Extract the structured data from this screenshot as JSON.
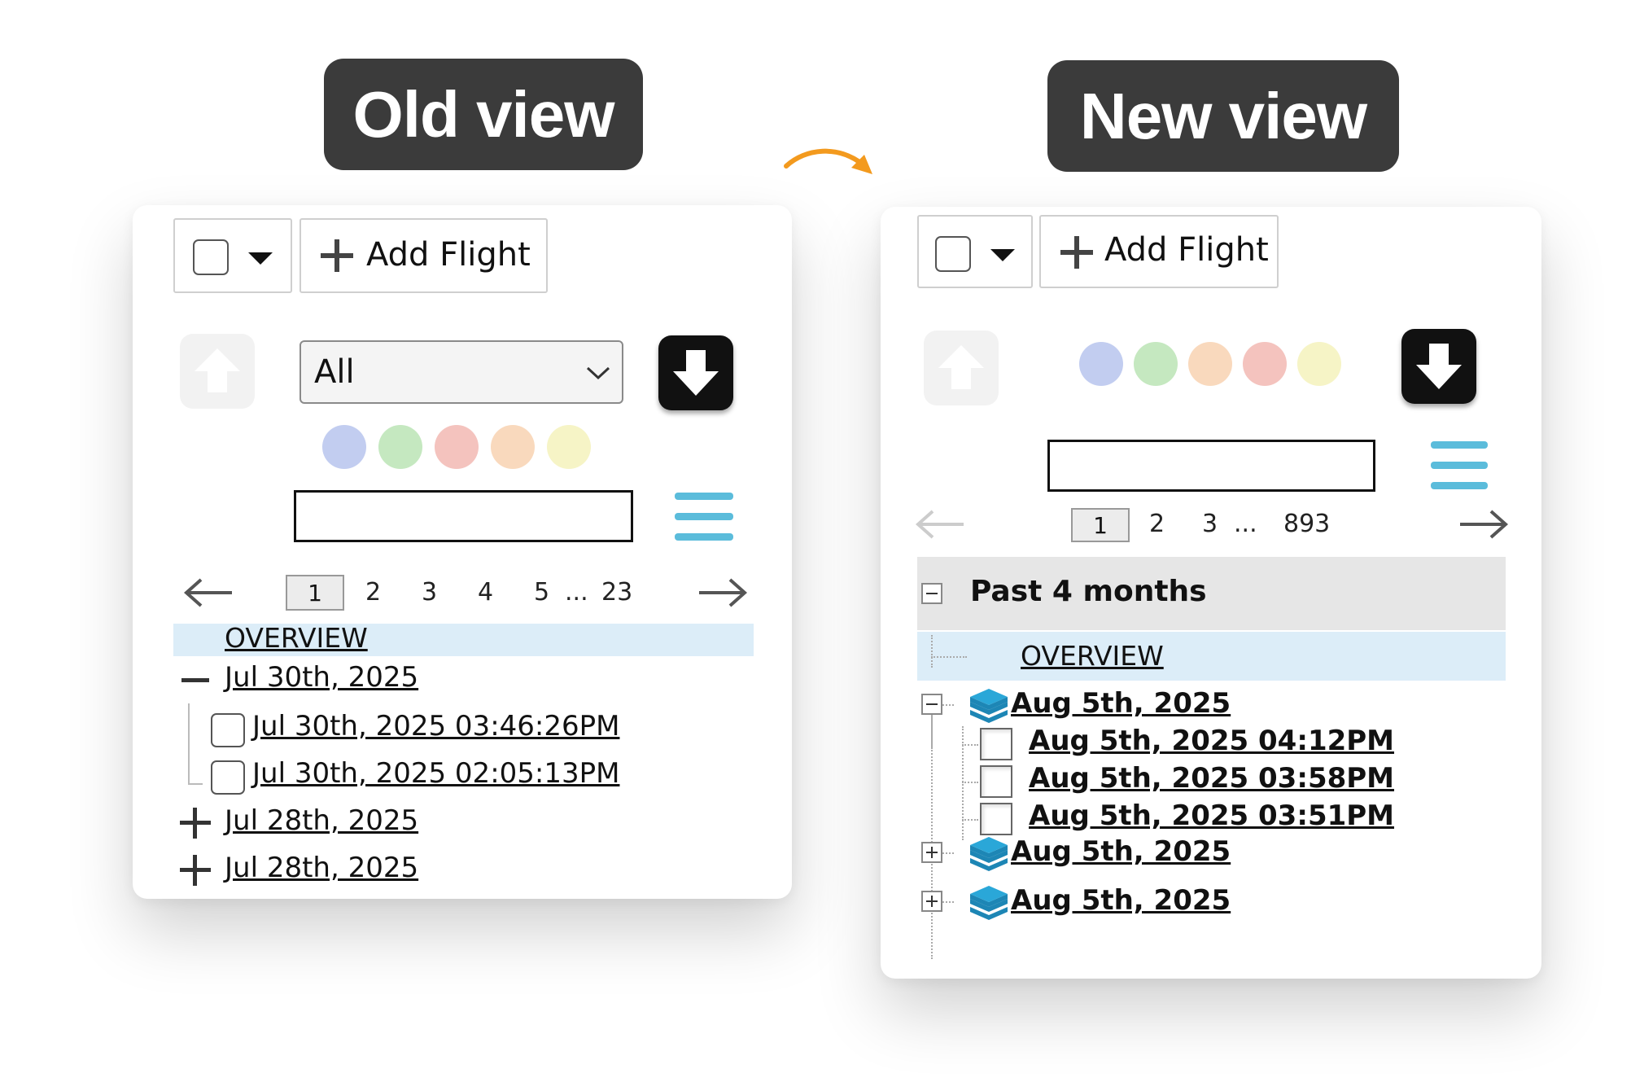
{
  "labels": {
    "old_view": "Old view",
    "new_view": "New view"
  },
  "colors": {
    "accent_arrow": "#f39a1e",
    "menu_blue": "#5bbcdb",
    "highlight": "#dcedf8",
    "layers_blue": "#2aa7d8"
  },
  "old": {
    "add_flight_label": "Add Flight",
    "filter_select": "All",
    "color_filters": [
      "#c2cdf0",
      "#c5e8c0",
      "#f4c3be",
      "#f9d9bd",
      "#f6f4c6"
    ],
    "search_value": "",
    "pagination": {
      "current": "1",
      "pages": [
        "2",
        "3",
        "4",
        "5"
      ],
      "ellipsis": "...",
      "last": "23"
    },
    "overview": "OVERVIEW",
    "groups": [
      {
        "label": "Jul 30th, 2025",
        "expanded": true,
        "flights": [
          "Jul 30th, 2025 03:46:26PM",
          "Jul 30th, 2025 02:05:13PM"
        ]
      },
      {
        "label": "Jul 28th, 2025",
        "expanded": false
      },
      {
        "label": "Jul 28th, 2025",
        "expanded": false
      }
    ]
  },
  "new": {
    "add_flight_label": "Add Flight",
    "color_filters": [
      "#c2cdf0",
      "#c5e8c0",
      "#f9d9bd",
      "#f4c3be",
      "#f6f4c6"
    ],
    "search_value": "",
    "pagination": {
      "current": "1",
      "pages": [
        "2",
        "3"
      ],
      "ellipsis": "...",
      "last": "893"
    },
    "section": "Past 4 months",
    "overview": "OVERVIEW",
    "groups": [
      {
        "label": "Aug 5th, 2025",
        "expanded": true,
        "flights": [
          "Aug 5th, 2025 04:12PM",
          "Aug 5th, 2025 03:58PM",
          "Aug 5th, 2025 03:51PM"
        ]
      },
      {
        "label": "Aug 5th, 2025",
        "expanded": false
      },
      {
        "label": "Aug 5th, 2025",
        "expanded": false
      }
    ]
  }
}
